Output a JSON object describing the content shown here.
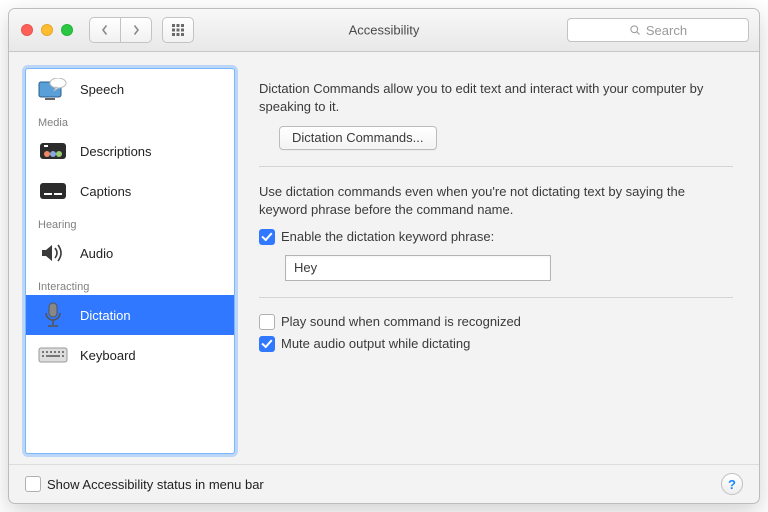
{
  "window": {
    "title": "Accessibility"
  },
  "toolbar": {
    "search_placeholder": "Search"
  },
  "sidebar": {
    "groups": [
      {
        "label": "",
        "items": [
          {
            "label": "Speech"
          }
        ]
      },
      {
        "label": "Media",
        "items": [
          {
            "label": "Descriptions"
          },
          {
            "label": "Captions"
          }
        ]
      },
      {
        "label": "Hearing",
        "items": [
          {
            "label": "Audio"
          }
        ]
      },
      {
        "label": "Interacting",
        "items": [
          {
            "label": "Dictation"
          },
          {
            "label": "Keyboard"
          }
        ]
      }
    ]
  },
  "main": {
    "intro": "Dictation Commands allow you to edit text and interact with your computer by speaking to it.",
    "dictation_commands_button": "Dictation Commands...",
    "keyword_desc": "Use dictation commands even when you're not dictating text by saying the keyword phrase before the command name.",
    "enable_keyword_label": "Enable the dictation keyword phrase:",
    "keyword_value": "Hey",
    "play_sound_label": "Play sound when command is recognized",
    "mute_label": "Mute audio output while dictating",
    "enable_keyword_checked": true,
    "play_sound_checked": false,
    "mute_checked": true
  },
  "footer": {
    "show_status_label": "Show Accessibility status in menu bar",
    "show_status_checked": false,
    "help_label": "?"
  }
}
